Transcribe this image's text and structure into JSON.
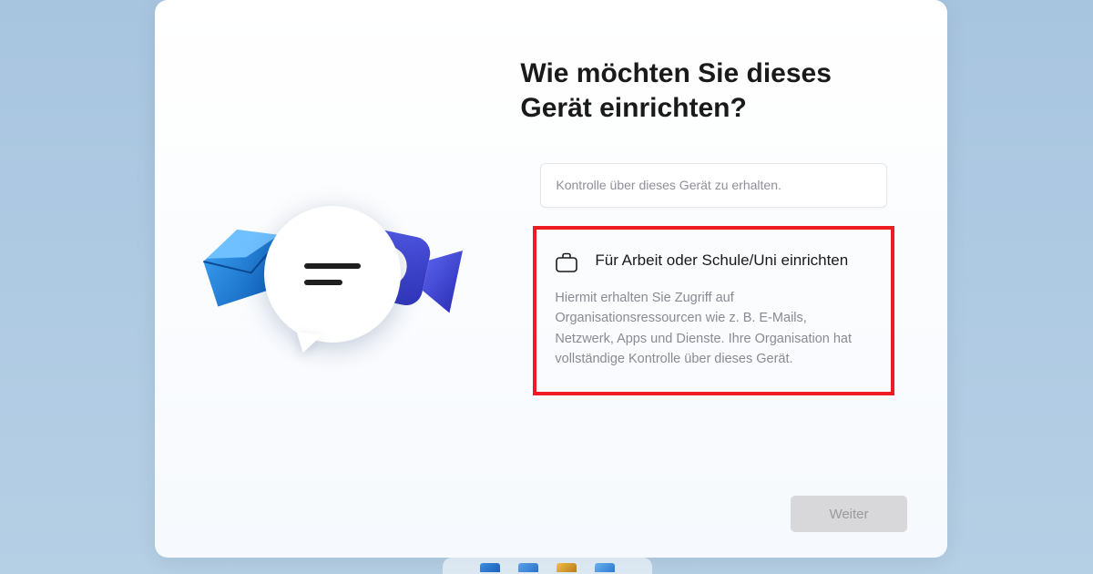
{
  "heading": "Wie möchten Sie dieses Gerät einrichten?",
  "options": {
    "truncated_prev": "Kontrolle über dieses Gerät zu erhalten.",
    "work": {
      "title": "Für Arbeit oder Schule/Uni einrichten",
      "desc": "Hiermit erhalten Sie Zugriff auf Organisationsressourcen wie z. B. E-Mails, Netzwerk, Apps und Dienste. Ihre Organisation hat vollständige Kontrolle über dieses Gerät."
    }
  },
  "buttons": {
    "next": "Weiter"
  },
  "illustration": {
    "envelope": "envelope-icon",
    "bubble": "speech-bubble-icon",
    "camera": "video-camera-icon"
  }
}
